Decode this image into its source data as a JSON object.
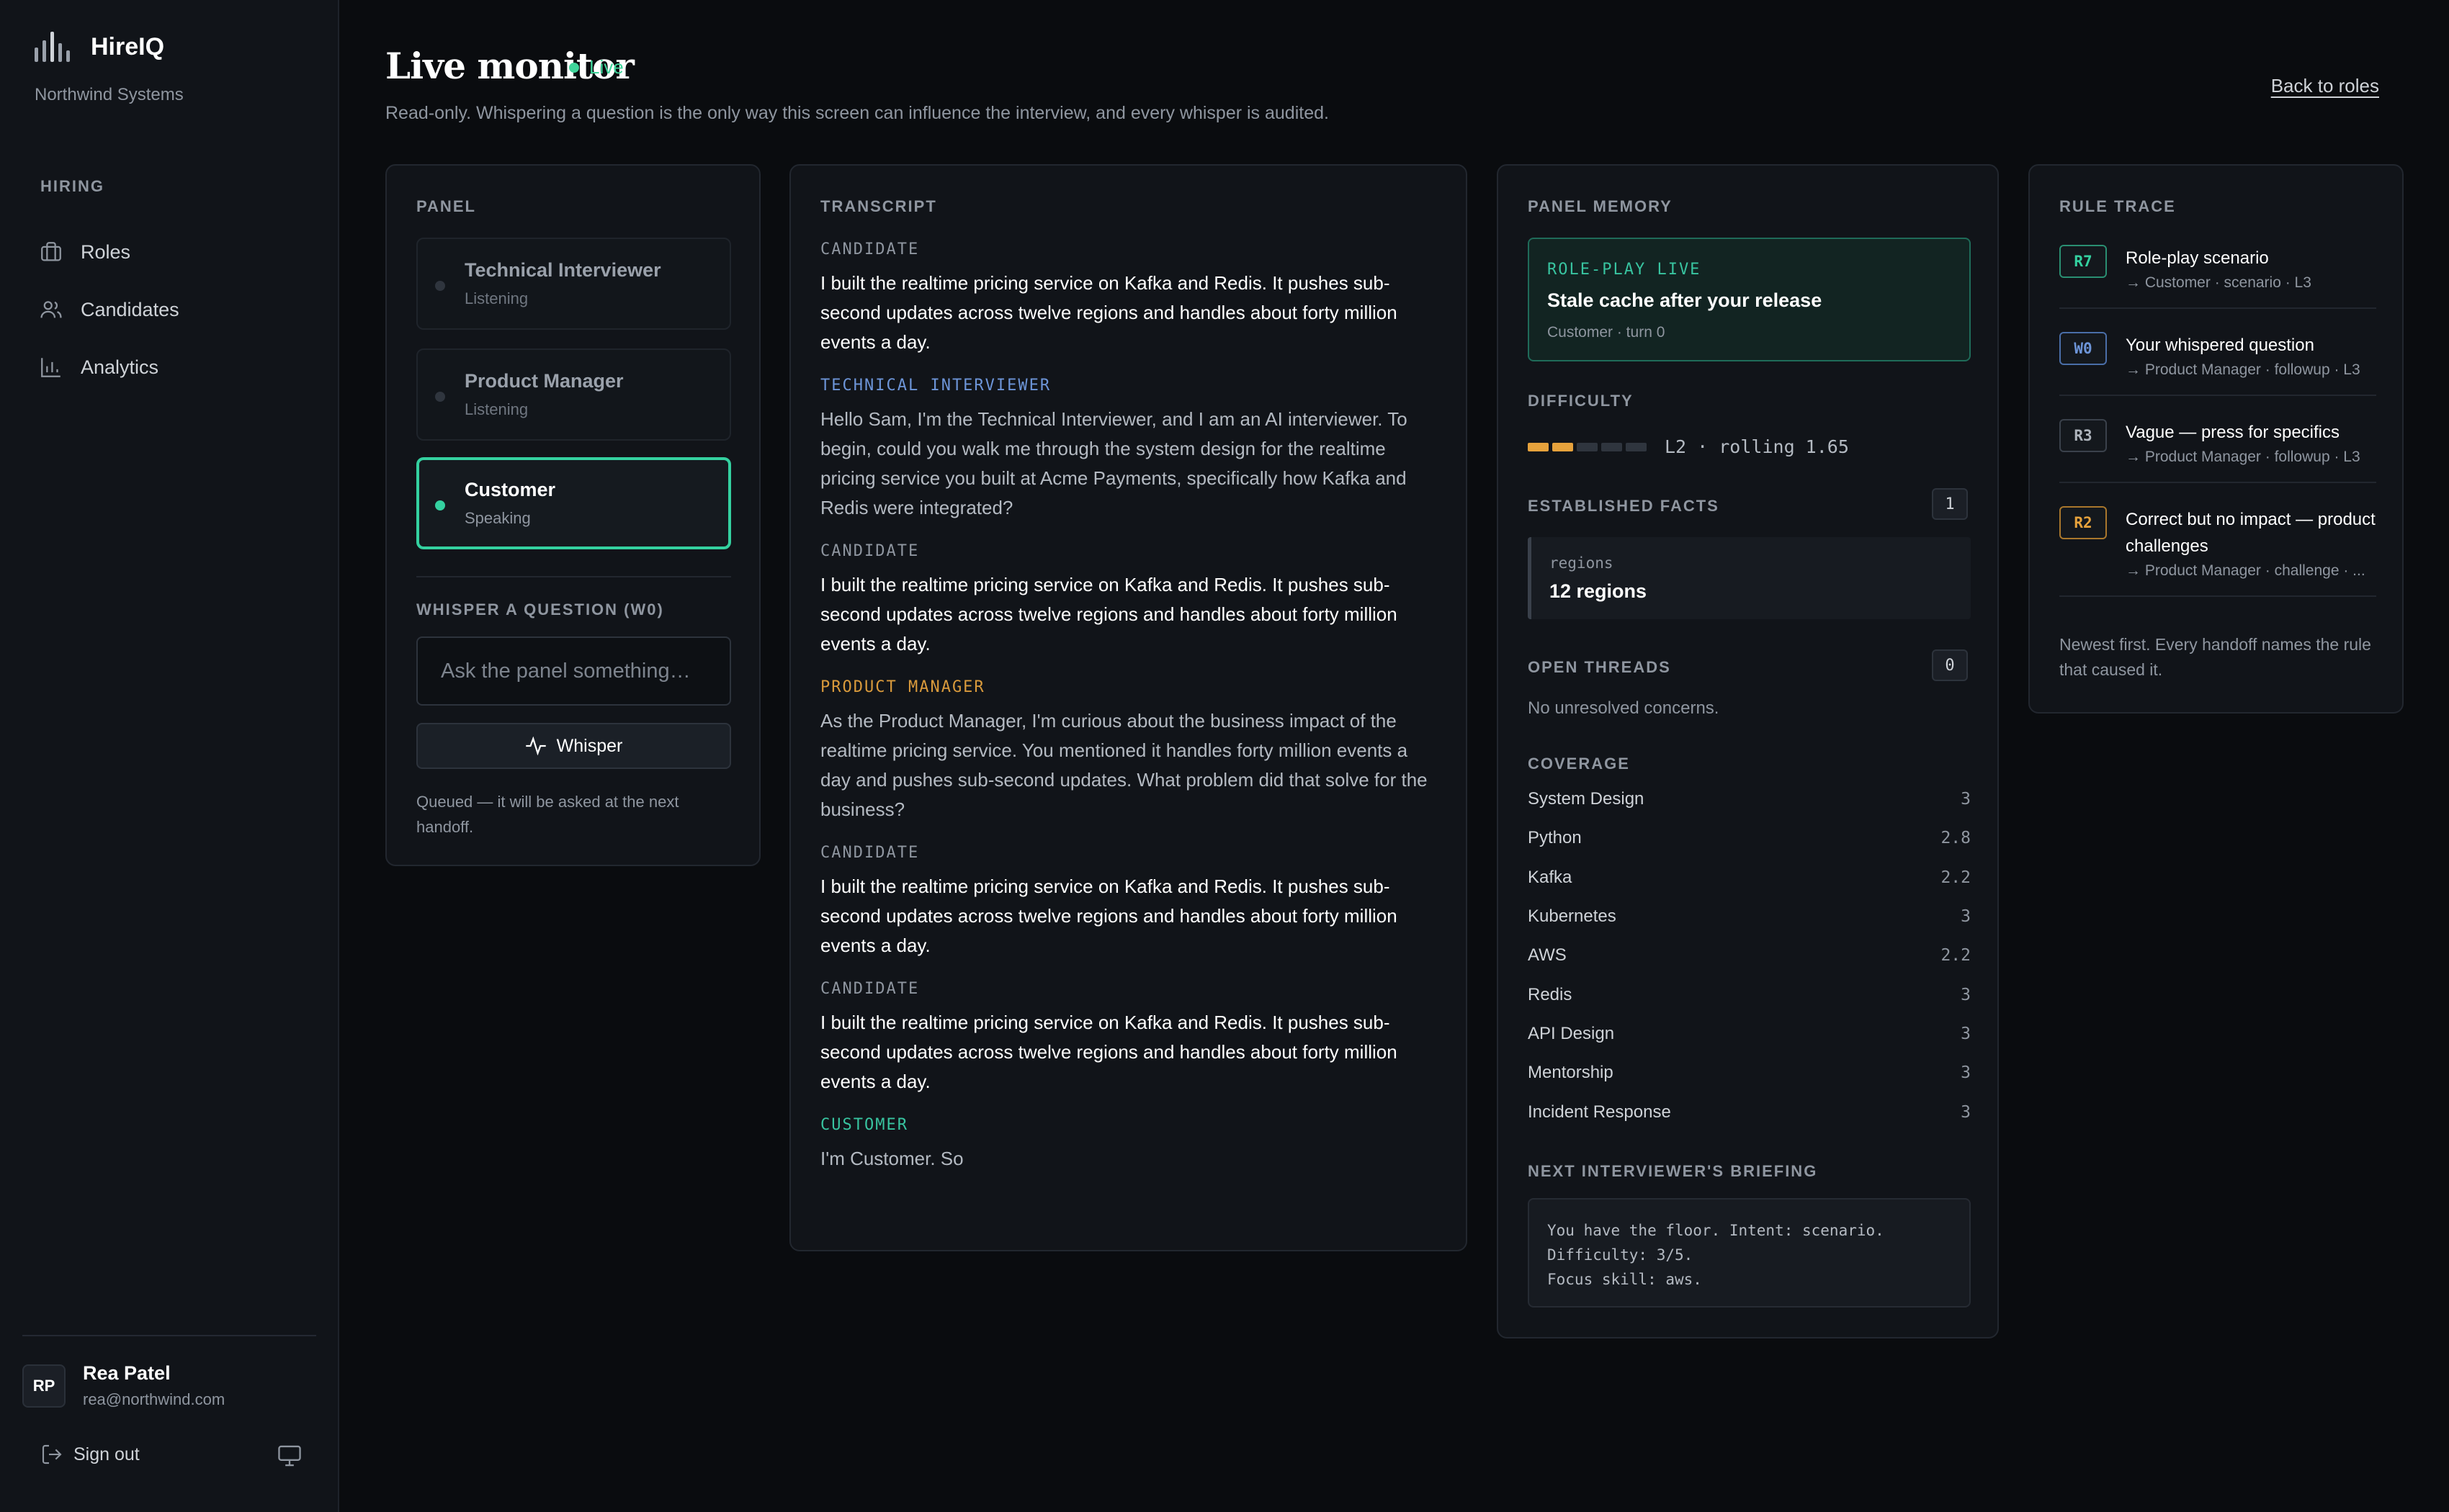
{
  "app": {
    "name": "HireIQ",
    "org": "Northwind Systems"
  },
  "sidebar": {
    "section": "HIRING",
    "items": [
      {
        "label": "Roles",
        "icon": "briefcase-icon"
      },
      {
        "label": "Candidates",
        "icon": "users-icon"
      },
      {
        "label": "Analytics",
        "icon": "bar-chart-icon"
      }
    ],
    "user": {
      "initials": "RP",
      "name": "Rea Patel",
      "email": "rea@northwind.com"
    },
    "sign_out": "Sign out"
  },
  "header": {
    "title": "Live monitor",
    "status": "Live",
    "subtitle": "Read-only. Whispering a question is the only way this screen can influence the interview, and every whisper is audited.",
    "back_link": "Back to roles"
  },
  "panel": {
    "label": "PANEL",
    "personas": [
      {
        "name": "Technical Interviewer",
        "status": "Listening"
      },
      {
        "name": "Product Manager",
        "status": "Listening"
      },
      {
        "name": "Customer",
        "status": "Speaking"
      }
    ],
    "whisper": {
      "label": "WHISPER A QUESTION (W0)",
      "placeholder": "Ask the panel something…",
      "button": "Whisper",
      "note": "Queued — it will be asked at the next handoff."
    }
  },
  "transcript": {
    "label": "TRANSCRIPT",
    "messages": [
      {
        "speaker": "CANDIDATE",
        "text": "I built the realtime pricing service on Kafka and Redis. It pushes sub-second updates across twelve regions and handles about forty million events a day."
      },
      {
        "speaker": "TECHNICAL INTERVIEWER",
        "text": "Hello Sam, I'm the Technical Interviewer, and I am an AI interviewer. To begin, could you walk me through the system design for the realtime pricing service you built at Acme Payments, specifically how Kafka and Redis were integrated?"
      },
      {
        "speaker": "CANDIDATE",
        "text": "I built the realtime pricing service on Kafka and Redis. It pushes sub-second updates across twelve regions and handles about forty million events a day."
      },
      {
        "speaker": "PRODUCT MANAGER",
        "text": "As the Product Manager, I'm curious about the business impact of the realtime pricing service. You mentioned it handles forty million events a day and pushes sub-second updates. What problem did that solve for the business?"
      },
      {
        "speaker": "CANDIDATE",
        "text": "I built the realtime pricing service on Kafka and Redis. It pushes sub-second updates across twelve regions and handles about forty million events a day."
      },
      {
        "speaker": "CANDIDATE",
        "text": "I built the realtime pricing service on Kafka and Redis. It pushes sub-second updates across twelve regions and handles about forty million events a day."
      },
      {
        "speaker": "CUSTOMER",
        "text": "I'm Customer. So"
      }
    ]
  },
  "memory": {
    "label": "PANEL MEMORY",
    "roleplay": {
      "tag": "ROLE-PLAY LIVE",
      "title": "Stale cache after your release",
      "sub": "Customer · turn 0"
    },
    "difficulty": {
      "label": "DIFFICULTY",
      "level": 2,
      "max": 5,
      "text": "L2 · rolling 1.65"
    },
    "facts": {
      "label": "ESTABLISHED FACTS",
      "count": "1",
      "items": [
        {
          "key": "regions",
          "value": "12 regions"
        }
      ]
    },
    "threads": {
      "label": "OPEN THREADS",
      "count": "0",
      "empty": "No unresolved concerns."
    },
    "coverage": {
      "label": "COVERAGE",
      "items": [
        {
          "skill": "System Design",
          "score": "3"
        },
        {
          "skill": "Python",
          "score": "2.8"
        },
        {
          "skill": "Kafka",
          "score": "2.2"
        },
        {
          "skill": "Kubernetes",
          "score": "3"
        },
        {
          "skill": "AWS",
          "score": "2.2"
        },
        {
          "skill": "Redis",
          "score": "3"
        },
        {
          "skill": "API Design",
          "score": "3"
        },
        {
          "skill": "Mentorship",
          "score": "3"
        },
        {
          "skill": "Incident Response",
          "score": "3"
        }
      ]
    },
    "briefing": {
      "label": "NEXT INTERVIEWER'S BRIEFING",
      "lines": [
        "You have the floor. Intent: scenario.",
        "Difficulty: 3/5.",
        "Focus skill: aws."
      ]
    }
  },
  "trace": {
    "label": "RULE TRACE",
    "items": [
      {
        "rule": "R7",
        "color": "#34d1a0",
        "title": "Role-play scenario",
        "sub": "→ Customer · scenario · L3"
      },
      {
        "rule": "W0",
        "color": "#6d95d8",
        "title": "Your whispered question",
        "sub": "→ Product Manager · followup · L3"
      },
      {
        "rule": "R3",
        "color": "#8f96a0",
        "title": "Vague — press for specifics",
        "sub": "→ Product Manager · followup · L3"
      },
      {
        "rule": "R2",
        "color": "#e6a23c",
        "title": "Correct but no impact — product challenges",
        "sub": "→ Product Manager · challenge · ..."
      }
    ],
    "note": "Newest first. Every handoff names the rule that caused it."
  },
  "colors": {
    "accent": "#34d1a0",
    "live": "#3fd49a",
    "technical": "#6d95d8",
    "product": "#d99a3c",
    "customer": "#38c4a0",
    "background": "#0a0c0f",
    "card": "#111419"
  }
}
